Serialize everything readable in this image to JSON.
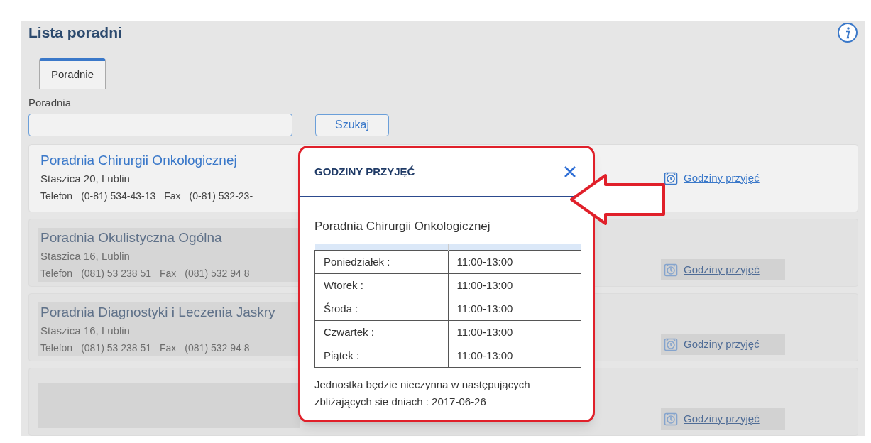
{
  "page": {
    "title": "Lista poradni"
  },
  "tabs": [
    {
      "label": "Poradnie",
      "selected": true
    }
  ],
  "search": {
    "label": "Poradnia",
    "button": "Szukaj"
  },
  "cards": [
    {
      "name": "Poradnia Chirurgii Onkologicznej",
      "address": "Staszica 20, Lublin",
      "phone_label": "Telefon",
      "phone": "(0-81) 534-43-13",
      "fax_label": "Fax",
      "fax": "(0-81) 532-23-",
      "link": "Godziny przyjęć",
      "disabled": false,
      "redacted": false
    },
    {
      "name": "Poradnia Okulistyczna Ogólna",
      "address": "Staszica 16, Lublin",
      "phone_label": "Telefon",
      "phone": "(081) 53 238 51",
      "fax_label": "Fax",
      "fax": "(081) 532 94 8",
      "link": "Godziny przyjęć",
      "disabled": true,
      "redacted": false
    },
    {
      "name": "Poradnia Diagnostyki i Leczenia Jaskry",
      "address": "Staszica 16, Lublin",
      "phone_label": "Telefon",
      "phone": "(081) 53 238 51",
      "fax_label": "Fax",
      "fax": "(081) 532 94 8",
      "link": "Godziny przyjęć",
      "disabled": true,
      "redacted": false
    },
    {
      "link": "Godziny przyjęć",
      "disabled": true,
      "redacted": true
    }
  ],
  "modal": {
    "title": "GODZINY PRZYJĘĆ",
    "clinic": "Poradnia Chirurgii Onkologicznej",
    "hours": [
      {
        "day": "Poniedziałek :",
        "time": "11:00-13:00"
      },
      {
        "day": "Wtorek :",
        "time": "11:00-13:00"
      },
      {
        "day": "Środa :",
        "time": "11:00-13:00"
      },
      {
        "day": "Czwartek :",
        "time": "11:00-13:00"
      },
      {
        "day": "Piątek :",
        "time": "11:00-13:00"
      }
    ],
    "note": "Jednostka będzie nieczynna w następujących zbliżających sie dniach : 2017-06-26"
  }
}
